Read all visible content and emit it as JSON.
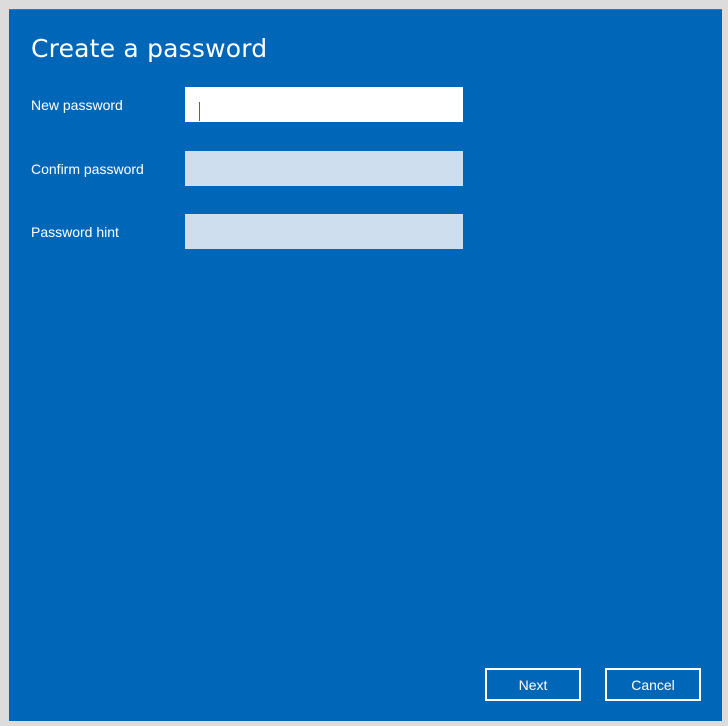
{
  "dialog": {
    "title": "Create a password",
    "accent_color": "#0067b8"
  },
  "form": {
    "new_password": {
      "label": "New password",
      "value": ""
    },
    "confirm_password": {
      "label": "Confirm password",
      "value": ""
    },
    "password_hint": {
      "label": "Password hint",
      "value": ""
    }
  },
  "buttons": {
    "next_label": "Next",
    "cancel_label": "Cancel"
  }
}
